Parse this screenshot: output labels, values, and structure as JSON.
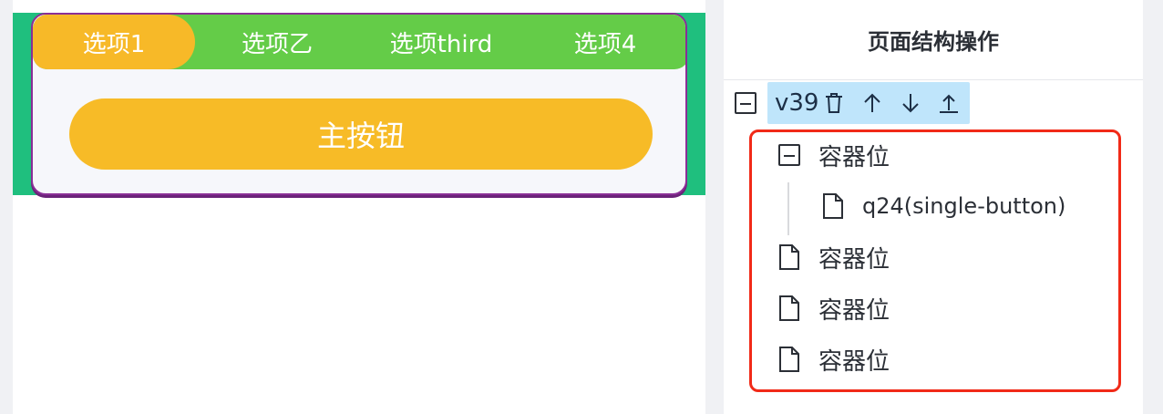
{
  "preview": {
    "tabs": [
      {
        "label": "选项1",
        "active": true
      },
      {
        "label": "选项乙",
        "active": false
      },
      {
        "label": "选项third",
        "active": false
      },
      {
        "label": "选项4",
        "active": false
      }
    ],
    "primary_button": "主按钮"
  },
  "panel": {
    "title": "页面结构操作",
    "root": {
      "label": "v39",
      "tools": [
        "trash-icon",
        "arrow-up-icon",
        "arrow-down-icon",
        "move-top-icon"
      ]
    },
    "children": [
      {
        "label": "容器位",
        "expanded": true,
        "children": [
          {
            "label": "q24(single-button)"
          }
        ]
      },
      {
        "label": "容器位"
      },
      {
        "label": "容器位"
      },
      {
        "label": "容器位"
      }
    ]
  },
  "colors": {
    "tab_bar": "#64cc48",
    "tab_active": "#f7b928",
    "button": "#f7bb27",
    "card_border": "#8a2e96",
    "band": "#1fbf7e",
    "root_highlight": "#bfe5fb",
    "selection_box": "#f12a18"
  }
}
